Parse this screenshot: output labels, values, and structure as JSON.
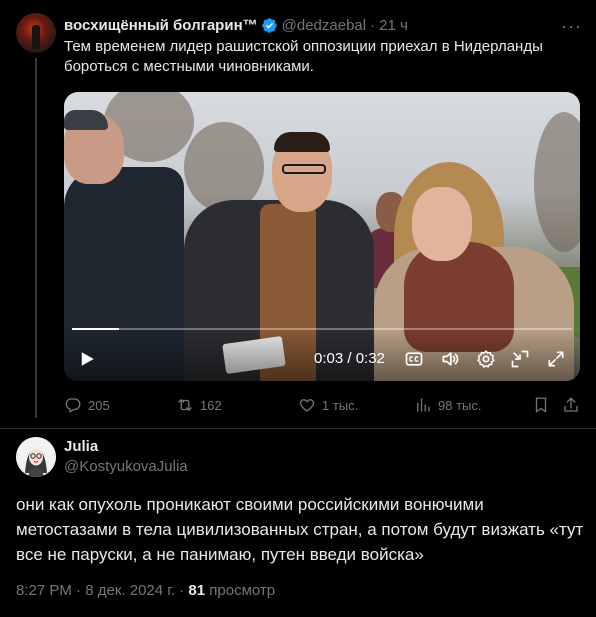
{
  "tweet": {
    "author_name": "восхищённый болгарин™",
    "handle": "@dedzaebal",
    "separator": "·",
    "time": "21 ч",
    "more_label": "···",
    "text": "Тем временем лидер рашистской оппозиции приехал в Нидерланды бороться с местными чиновниками.",
    "video": {
      "time_readout": "0:03 / 0:32",
      "progress_fraction": 0.094
    },
    "actions": {
      "replies": "205",
      "retweets": "162",
      "likes": "1 тыс.",
      "views": "98 тыс."
    }
  },
  "reply": {
    "author_name": "Julia",
    "handle": "@KostyukovaJulia",
    "text": "они как опухоль проникают своими российскими вонючими метостазами в тела цивилизованных стран, а потом будут визжать «тут все не паруски, а не панимаю, путен введи войска»",
    "meta": {
      "time": "8:27 PM",
      "sep1": "·",
      "date": "8 дек. 2024 г.",
      "sep2": "·",
      "views_count": "81",
      "views_label": "просмотр"
    }
  },
  "colors": {
    "background": "#000000",
    "text": "#e7e9ea",
    "muted": "#71767b",
    "verified": "#1d9bf0",
    "divider": "#2f3336"
  },
  "icons": [
    "verified-badge-icon",
    "more-icon",
    "play-icon",
    "captions-icon",
    "volume-icon",
    "settings-icon",
    "minimize-icon",
    "fullscreen-icon",
    "reply-icon",
    "retweet-icon",
    "like-icon",
    "views-icon",
    "bookmark-icon",
    "share-icon"
  ]
}
